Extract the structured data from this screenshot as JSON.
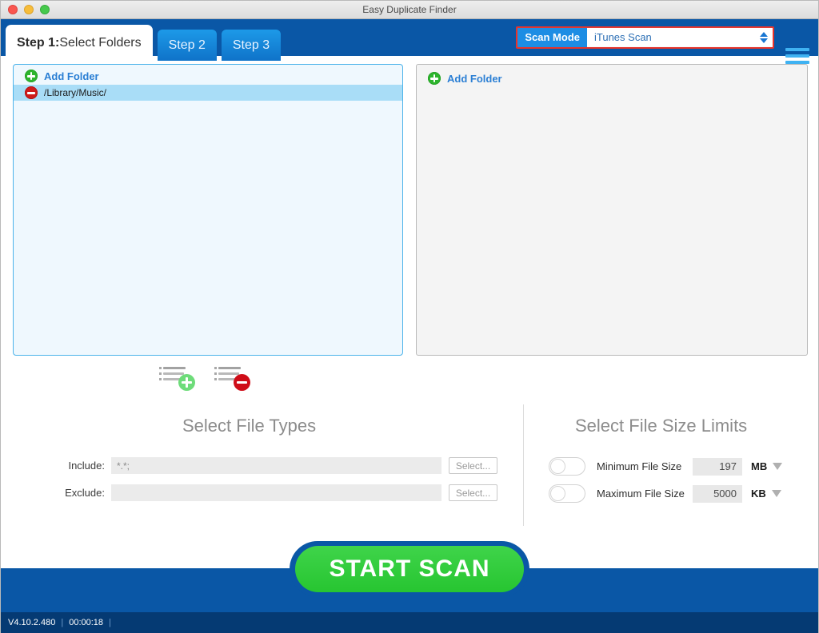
{
  "window": {
    "title": "Easy Duplicate Finder",
    "traffic_lights": [
      "close-button",
      "minimize-button",
      "zoom-button"
    ]
  },
  "toolbar": {
    "tabs": [
      {
        "label": "Step 1:  Select Folders",
        "strong": "Step 1:",
        "rest": " Select Folders",
        "active": true
      },
      {
        "label": "Step 2",
        "active": false
      },
      {
        "label": "Step 3",
        "active": false
      }
    ],
    "scan_mode": {
      "label": "Scan Mode",
      "value": "iTunes Scan",
      "highlight_color": "#e8332a",
      "label_bg": "#1d8de4"
    },
    "menu_icon": "hamburger-icon",
    "background": "#0a57a6"
  },
  "panels": {
    "left": {
      "add_folder_label": "Add Folder",
      "folders": [
        {
          "path": "/Library/Music/",
          "selected": true
        }
      ],
      "border_color": "#4cb3ea",
      "background": "#eff8fe"
    },
    "right": {
      "add_folder_label": "Add Folder",
      "folders": [],
      "border_color": "#b9b9b9",
      "background": "#f4f4f4"
    }
  },
  "list_actions": [
    {
      "name": "add-list-icon",
      "badge": "plus",
      "badge_color": "#6edc7a"
    },
    {
      "name": "remove-list-icon",
      "badge": "minus",
      "badge_color": "#cf0d18"
    }
  ],
  "file_types": {
    "title": "Select File Types",
    "include": {
      "label": "Include:",
      "value": "*.*;",
      "button": "Select..."
    },
    "exclude": {
      "label": "Exclude:",
      "value": "",
      "button": "Select..."
    }
  },
  "file_size": {
    "title": "Select File Size Limits",
    "rows": [
      {
        "label": "Minimum File Size",
        "value": "197",
        "unit": "MB",
        "enabled": false
      },
      {
        "label": "Maximum File Size",
        "value": "5000",
        "unit": "KB",
        "enabled": false
      }
    ]
  },
  "action": {
    "start_scan_label": "START  SCAN",
    "button_color": "#27c531",
    "ring_color": "#0a57a6"
  },
  "status_bar": {
    "version": "V4.10.2.480",
    "separator1": "|",
    "elapsed": "00:00:18",
    "separator2": "|",
    "background": "#053a73"
  }
}
